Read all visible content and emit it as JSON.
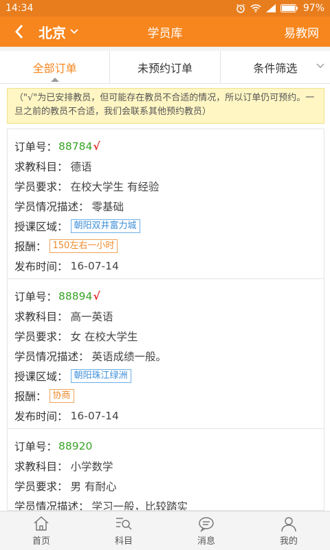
{
  "status_bar": {
    "time": "14:34",
    "battery": "97%"
  },
  "header": {
    "city": "北京",
    "title": "学员库",
    "brand": "易教网"
  },
  "tabs": [
    {
      "label": "全部订单"
    },
    {
      "label": "未预约订单"
    },
    {
      "label": "条件筛选"
    }
  ],
  "notice": "（\"√\"为已安排教员，但可能存在教员不合适的情况，所以订单仍可预约。一旦之前的教员不合适，我们会联系其他预约教员）",
  "labels": {
    "order_no": "订单号：",
    "subject": "求教科目：",
    "requirement": "学员要求：",
    "description": "学员情况描述：",
    "area": "授课区域：",
    "pay": "报酬：",
    "published": "发布时间：",
    "check_mark": "√"
  },
  "orders": [
    {
      "id": "88784",
      "subject": "德语",
      "requirement": "在校大学生 有经验",
      "description": "零基础",
      "area": "朝阳双井富力城",
      "pay": "150左右一小时",
      "published": "16-07-14"
    },
    {
      "id": "88894",
      "subject": "高一英语",
      "requirement": "女 在校大学生",
      "description": "英语成绩一般。",
      "area": "朝阳珠江绿洲",
      "pay": "协商",
      "published": "16-07-14"
    },
    {
      "id": "88920",
      "subject": "小学数学",
      "requirement": "男 有耐心",
      "description": "学习一般，比较踏实"
    }
  ],
  "bottom_nav": [
    {
      "label": "首页",
      "icon": "home-icon"
    },
    {
      "label": "科目",
      "icon": "subject-search-icon"
    },
    {
      "label": "消息",
      "icon": "message-icon"
    },
    {
      "label": "我的",
      "icon": "user-icon"
    }
  ],
  "colors": {
    "primary": "#f7861e",
    "order_id": "#3aa328",
    "check": "#e52d2d"
  }
}
